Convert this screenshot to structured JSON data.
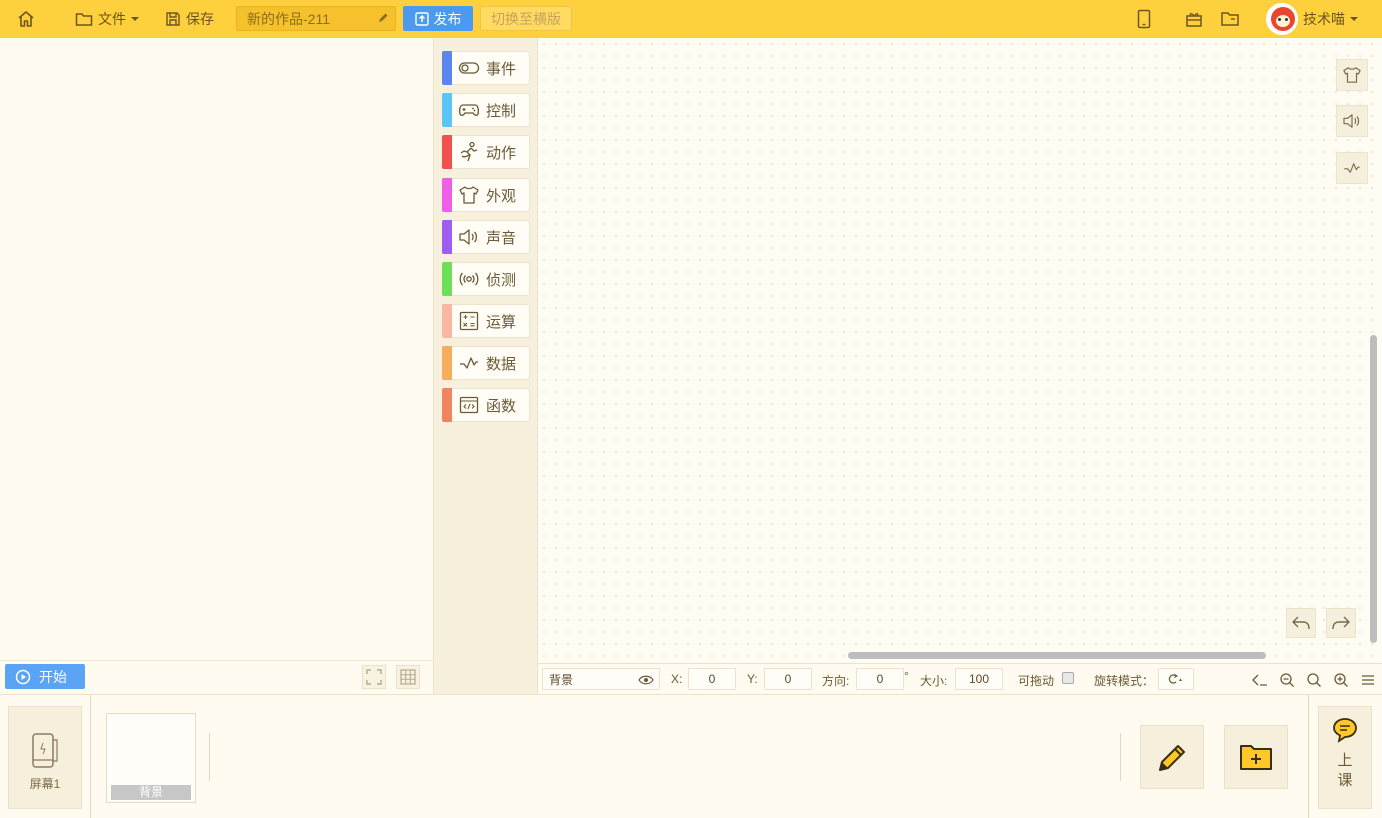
{
  "topbar": {
    "file_label": "文件",
    "save_label": "保存",
    "project_title": "新的作品-211",
    "publish_label": "发布",
    "switch_label": "切换至横版",
    "user_name": "技术喵"
  },
  "categories": [
    {
      "label": "事件",
      "color": "#5b86f0",
      "icon": "toggle-icon"
    },
    {
      "label": "控制",
      "color": "#5bc6f5",
      "icon": "gamepad-icon"
    },
    {
      "label": "动作",
      "color": "#f05050",
      "icon": "running-icon"
    },
    {
      "label": "外观",
      "color": "#ee5ee6",
      "icon": "shirt-icon"
    },
    {
      "label": "声音",
      "color": "#a05ef0",
      "icon": "speaker-icon"
    },
    {
      "label": "侦测",
      "color": "#6de05a",
      "icon": "sensor-icon"
    },
    {
      "label": "运算",
      "color": "#f7b9a4",
      "icon": "calculator-icon"
    },
    {
      "label": "数据",
      "color": "#f5ad5e",
      "icon": "data-icon"
    },
    {
      "label": "函数",
      "color": "#f0845e",
      "icon": "function-icon"
    }
  ],
  "stage": {
    "start_label": "开始"
  },
  "properties": {
    "sprite_name": "背景",
    "x_label": "X:",
    "x_value": "0",
    "y_label": "Y:",
    "y_value": "0",
    "direction_label": "方向:",
    "direction_value": "0",
    "degree_symbol": "°",
    "size_label": "大小:",
    "size_value": "100",
    "draggable_label": "可拖动",
    "rotation_label": "旋转模式："
  },
  "bottom": {
    "screen_label": "屏幕1",
    "sprite_label": "背景",
    "class_label": "上课"
  }
}
